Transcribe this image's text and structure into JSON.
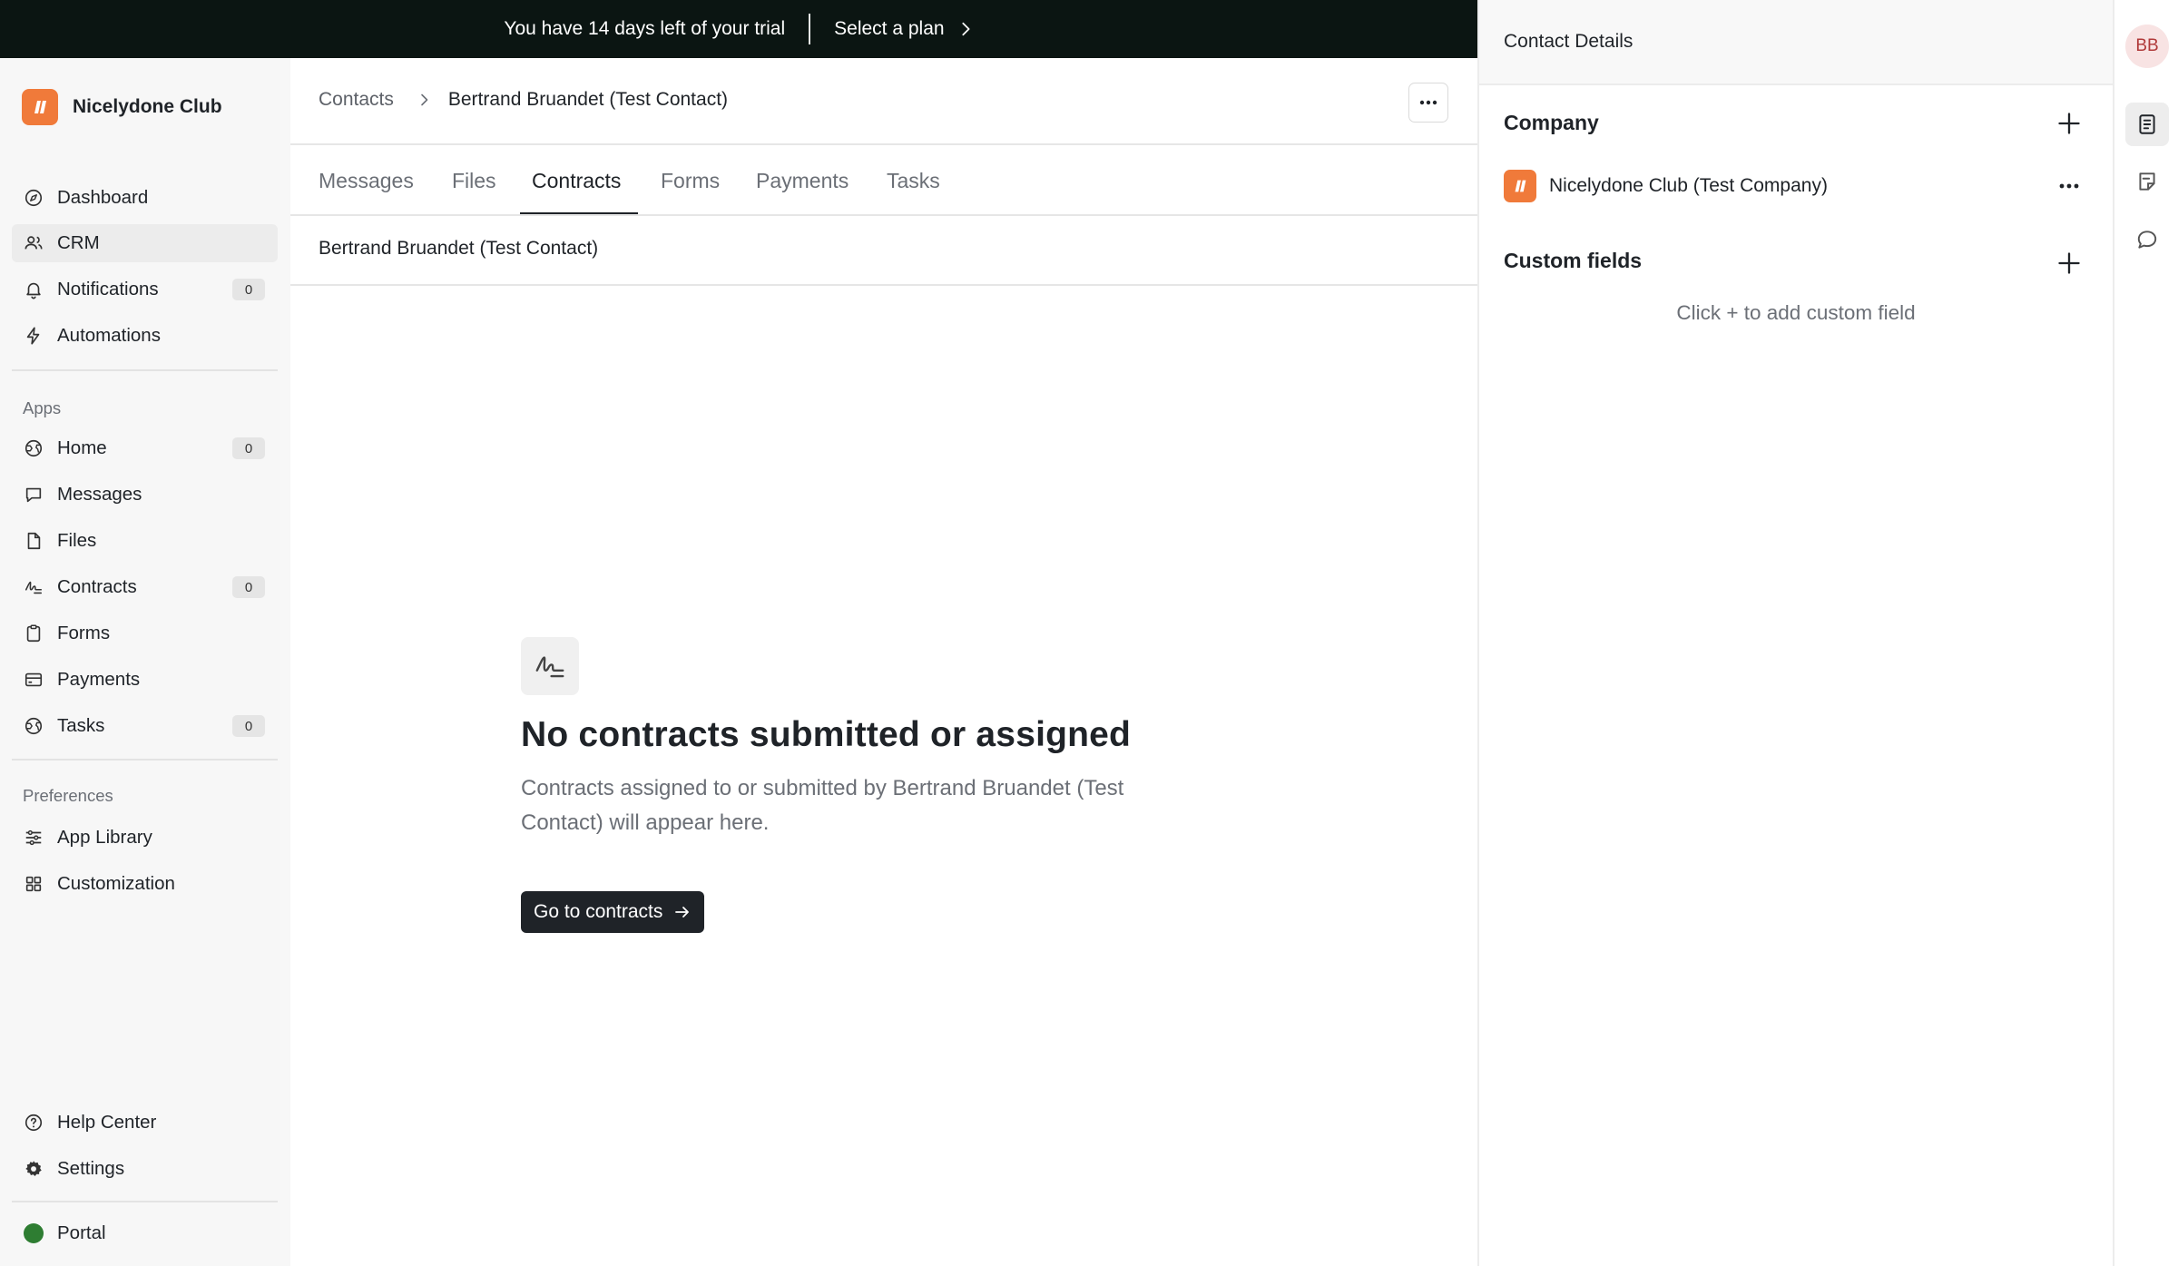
{
  "banner": {
    "trial_text": "You have 14 days left of your trial",
    "plan_label": "Select a plan"
  },
  "sidebar": {
    "brand": "Nicelydone Club",
    "main_items": [
      {
        "label": "Dashboard",
        "icon": "compass-icon"
      },
      {
        "label": "CRM",
        "icon": "users-icon"
      },
      {
        "label": "Notifications",
        "icon": "bell-icon",
        "badge": "0"
      },
      {
        "label": "Automations",
        "icon": "bolt-icon"
      }
    ],
    "apps_label": "Apps",
    "app_items": [
      {
        "label": "Home",
        "icon": "globe-icon",
        "badge": "0"
      },
      {
        "label": "Messages",
        "icon": "chat-icon"
      },
      {
        "label": "Files",
        "icon": "file-icon"
      },
      {
        "label": "Contracts",
        "icon": "signature-icon",
        "badge": "0"
      },
      {
        "label": "Forms",
        "icon": "clipboard-icon"
      },
      {
        "label": "Payments",
        "icon": "card-icon"
      },
      {
        "label": "Tasks",
        "icon": "globe-icon",
        "badge": "0"
      }
    ],
    "preferences_label": "Preferences",
    "pref_items": [
      {
        "label": "App Library",
        "icon": "sliders-icon"
      },
      {
        "label": "Customization",
        "icon": "grid-icon"
      }
    ],
    "bottom_items": [
      {
        "label": "Help Center",
        "icon": "help-icon"
      },
      {
        "label": "Settings",
        "icon": "gear-icon"
      }
    ],
    "portal_label": "Portal"
  },
  "main": {
    "breadcrumb": {
      "root": "Contacts",
      "current": "Bertrand Bruandet (Test Contact)"
    },
    "tabs": [
      "Messages",
      "Files",
      "Contracts",
      "Forms",
      "Payments",
      "Tasks"
    ],
    "active_tab": "Contracts",
    "sub_title": "Bertrand Bruandet (Test Contact)",
    "empty": {
      "title": "No contracts submitted or assigned",
      "description": "Contracts assigned to or submitted by Bertrand Bruandet (Test Contact) will appear here.",
      "cta": "Go to contracts"
    }
  },
  "details": {
    "title": "Contact Details",
    "company_heading": "Company",
    "company_name": "Nicelydone Club (Test Company)",
    "custom_fields_heading": "Custom fields",
    "custom_fields_hint": "Click + to add custom field"
  },
  "rail": {
    "avatar_initials": "BB"
  },
  "colors": {
    "banner_bg": "#0b1512",
    "brand_orange": "#f07a3a",
    "portal_green": "#2e7d32",
    "cta_bg": "#1f2328"
  }
}
